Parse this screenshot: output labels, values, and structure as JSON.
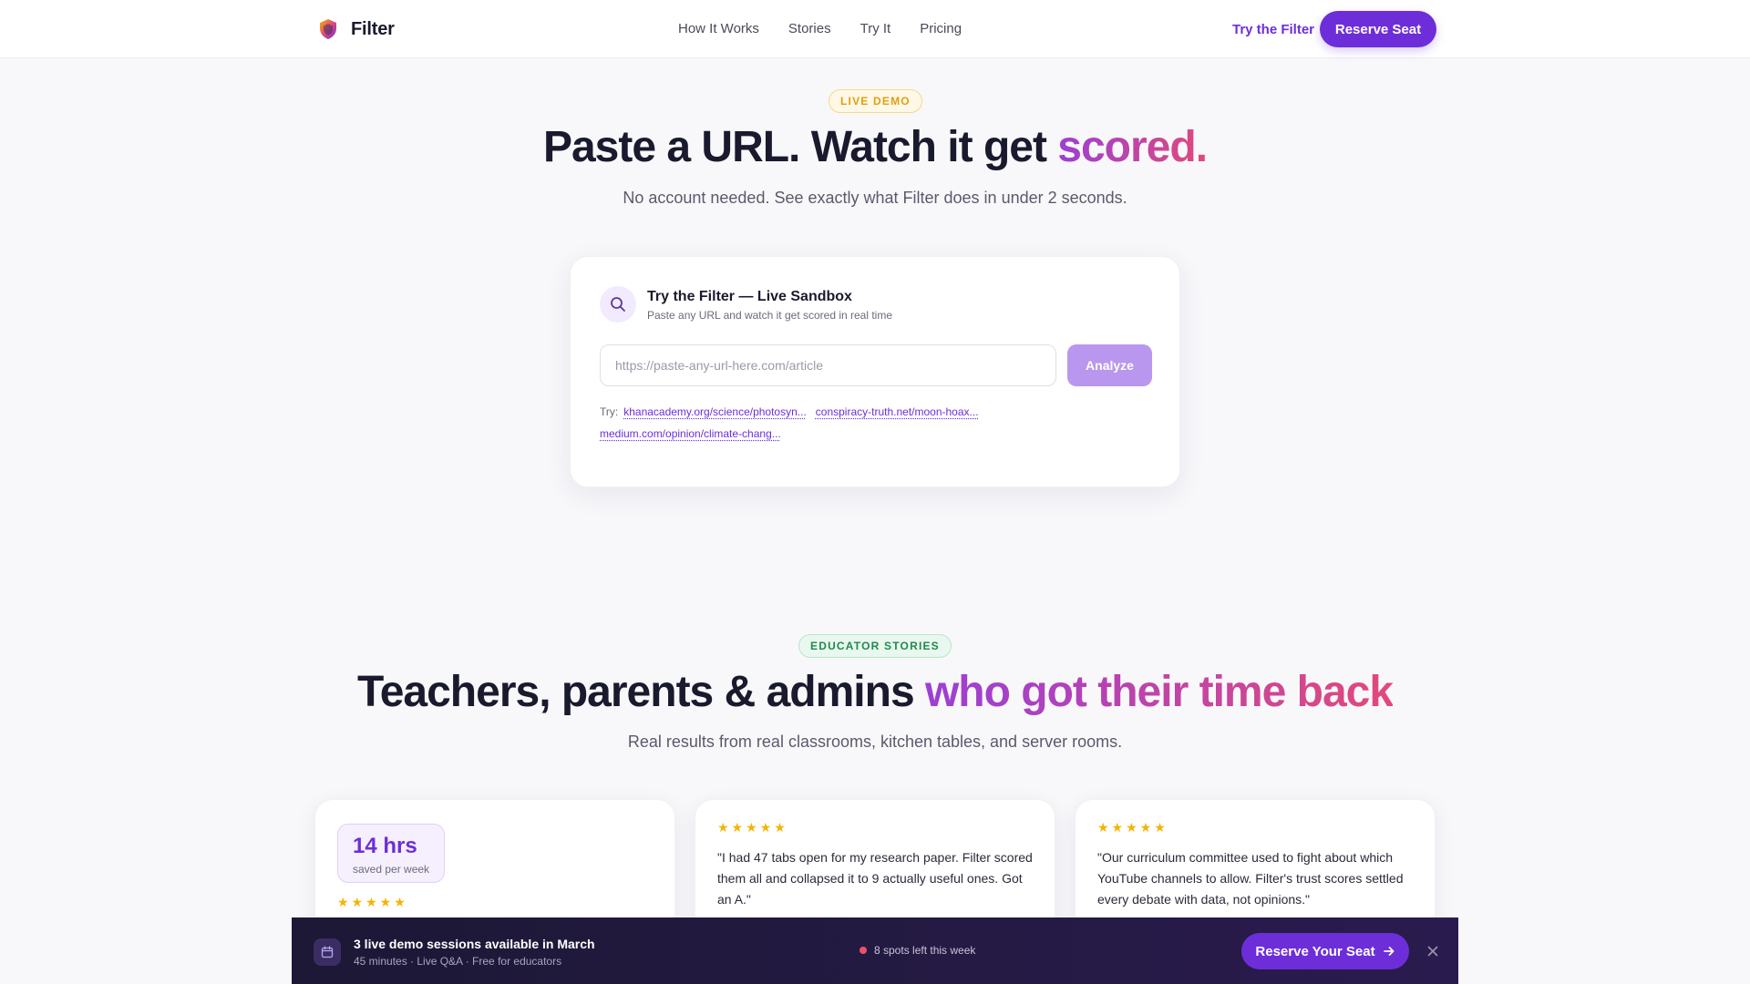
{
  "nav": {
    "brand": "Filter",
    "links": [
      "How It Works",
      "Stories",
      "Try It",
      "Pricing"
    ],
    "try_link": "Try the Filter",
    "reserve_button": "Reserve Seat"
  },
  "hero": {
    "badge": "LIVE DEMO",
    "title_plain": "Paste a URL. Watch it get ",
    "title_accent": "scored.",
    "subtitle": "No account needed. See exactly what Filter does in under 2 seconds."
  },
  "sandbox": {
    "title": "Try the Filter — Live Sandbox",
    "description": "Paste any URL and watch it get scored in real time",
    "input_value": "",
    "input_placeholder": "https://paste-any-url-here.com/article",
    "analyze_button": "Analyze",
    "try_label": "Try:",
    "examples": [
      "khanacademy.org/science/photosyn...",
      "conspiracy-truth.net/moon-hoax...",
      "medium.com/opinion/climate-chang..."
    ]
  },
  "stories": {
    "badge": "EDUCATOR STORIES",
    "title_plain": "Teachers, parents & admins ",
    "title_accent": "who got their time back",
    "subtitle": "Real results from real classrooms, kitchen tables, and server rooms.",
    "cards": [
      {
        "stat_value": "14 hrs",
        "stat_label": "saved per week",
        "rating": 5,
        "stars": "★★★★★"
      },
      {
        "rating": 5,
        "stars": "★★★★★",
        "quote": "\"I had 47 tabs open for my research paper. Filter scored them all and collapsed it to 9 actually useful ones. Got an A.\""
      },
      {
        "rating": 5,
        "stars": "★★★★★",
        "quote": "\"Our curriculum committee used to fight about which YouTube channels to allow. Filter's trust scores settled every debate with data, not opinions.\""
      }
    ]
  },
  "announcement": {
    "title": "3 live demo sessions available in March",
    "subtitle": "45 minutes · Live Q&A · Free for educators",
    "spots": "8 spots left this week",
    "button": "Reserve Your Seat"
  },
  "colors": {
    "accent": "#6d2ed9",
    "gradient_start": "#9b3fd6",
    "gradient_end": "#e2497a",
    "star": "#f4b400",
    "live_badge": "#e0a010",
    "stories_badge": "#1f8a4c",
    "spots_dot": "#f0506e"
  },
  "icons": {
    "brand": "shield-logo-icon",
    "sandbox": "search-icon",
    "announcement": "calendar-icon",
    "button_arrow": "arrow-right-icon",
    "close": "close-icon"
  }
}
